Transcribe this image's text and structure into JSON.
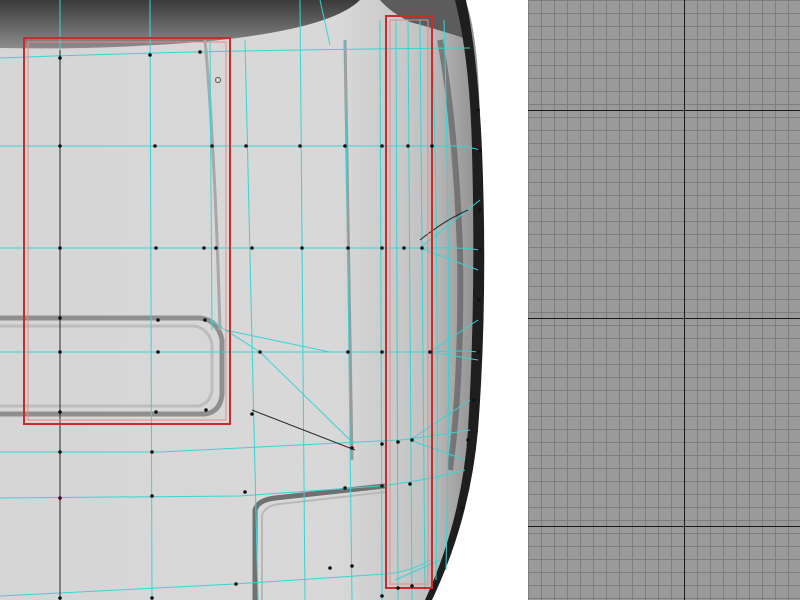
{
  "app": {
    "viewport_left_label": "",
    "viewport_right_label": ""
  },
  "colors": {
    "background_light": "#dcdcdc",
    "edge_cyan": "#39d3d3",
    "selection_red": "#cc2b2b",
    "vertex_dark": "#111111",
    "grid_background": "#9a9a9a",
    "grid_line": "#7e7e7e",
    "axis_line": "#1a1a1a"
  }
}
